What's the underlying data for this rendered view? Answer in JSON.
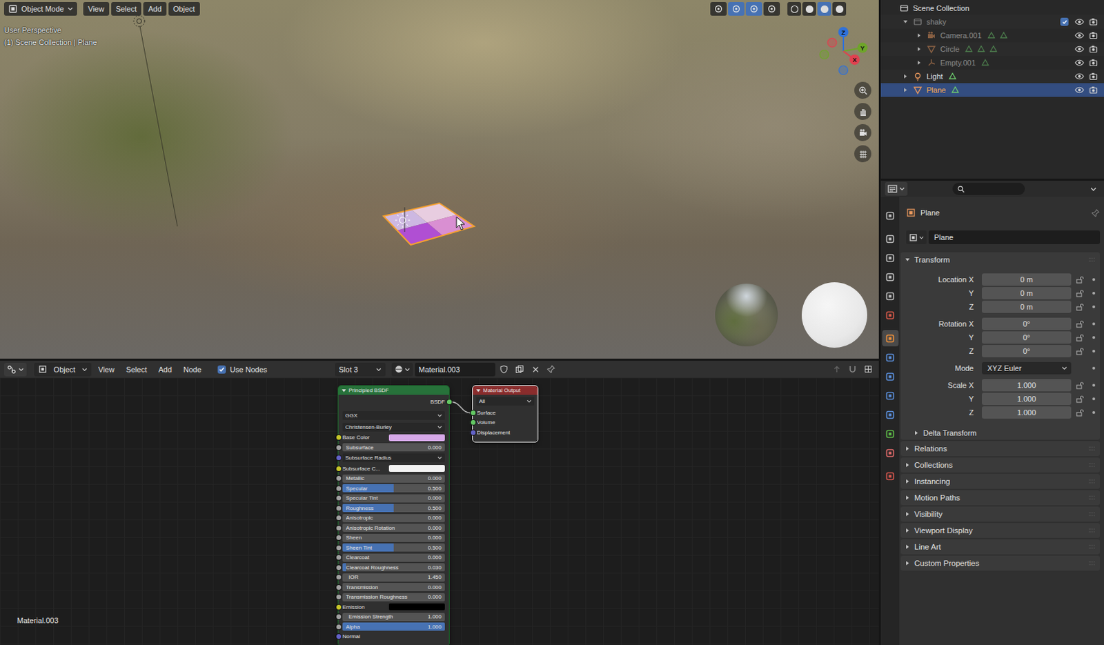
{
  "viewport": {
    "mode": "Object Mode",
    "menus": [
      "View",
      "Select",
      "Add",
      "Object"
    ],
    "toggles": [
      {
        "active": false
      },
      {
        "active": true
      },
      {
        "active": true
      },
      {
        "active": false
      }
    ],
    "shading": [
      {
        "selected": false
      },
      {
        "selected": false
      },
      {
        "selected": true
      },
      {
        "selected": false
      }
    ],
    "info": [
      "User Perspective",
      "(1) Scene Collection | Plane"
    ],
    "axes": [
      {
        "label": "Z",
        "color": "#2f71d9"
      },
      {
        "label": "Y",
        "color": "#6ea529"
      },
      {
        "label": "X",
        "color": "#e0404f"
      }
    ]
  },
  "node_editor": {
    "editor_mode": "Object",
    "menus": [
      "View",
      "Select",
      "Add",
      "Node"
    ],
    "use_nodes": {
      "label": "Use Nodes",
      "checked": true
    },
    "slot": "Slot 3",
    "material": "Material.003",
    "footer": "Material.003",
    "principled": {
      "title": "Principled BSDF",
      "output": {
        "label": "BSDF",
        "color": "#63c763"
      },
      "inputs": [
        {
          "kind": "dropdown",
          "label": "GGX"
        },
        {
          "kind": "dropdown",
          "label": "Christensen-Burley"
        },
        {
          "kind": "color",
          "label": "Base Color",
          "swatch": "#d6a9e8",
          "color": "#c7c729"
        },
        {
          "kind": "value",
          "label": "Subsurface",
          "value": "0.000",
          "level": 0,
          "color": "#a1a1a1"
        },
        {
          "kind": "vector",
          "label": "Subsurface Radius",
          "color": "#6363c7"
        },
        {
          "kind": "color",
          "label": "Subsurface C...",
          "swatch": "#f2f2f2",
          "color": "#c7c729"
        },
        {
          "kind": "value",
          "label": "Metallic",
          "value": "0.000",
          "level": 0,
          "color": "#a1a1a1"
        },
        {
          "kind": "value",
          "label": "Specular",
          "value": "0.500",
          "level": 0.5,
          "color": "#a1a1a1"
        },
        {
          "kind": "value",
          "label": "Specular Tint",
          "value": "0.000",
          "level": 0,
          "color": "#a1a1a1"
        },
        {
          "kind": "value",
          "label": "Roughness",
          "value": "0.500",
          "level": 0.5,
          "color": "#a1a1a1"
        },
        {
          "kind": "value",
          "label": "Anisotropic",
          "value": "0.000",
          "level": 0,
          "color": "#a1a1a1"
        },
        {
          "kind": "value",
          "label": "Anisotropic Rotation",
          "value": "0.000",
          "level": 0,
          "color": "#a1a1a1"
        },
        {
          "kind": "value",
          "label": "Sheen",
          "value": "0.000",
          "level": 0,
          "color": "#a1a1a1"
        },
        {
          "kind": "value",
          "label": "Sheen Tint",
          "value": "0.500",
          "level": 0.5,
          "color": "#a1a1a1"
        },
        {
          "kind": "value",
          "label": "Clearcoat",
          "value": "0.000",
          "level": 0,
          "color": "#a1a1a1"
        },
        {
          "kind": "value",
          "label": "Clearcoat Roughness",
          "value": "0.030",
          "level": 0.03,
          "color": "#a1a1a1"
        },
        {
          "kind": "field",
          "label": "IOR",
          "value": "1.450",
          "color": "#a1a1a1"
        },
        {
          "kind": "value",
          "label": "Transmission",
          "value": "0.000",
          "level": 0,
          "color": "#a1a1a1"
        },
        {
          "kind": "value",
          "label": "Transmission Roughness",
          "value": "0.000",
          "level": 0,
          "color": "#a1a1a1"
        },
        {
          "kind": "color",
          "label": "Emission",
          "swatch": "#000000",
          "color": "#c7c729"
        },
        {
          "kind": "field",
          "label": "Emission Strength",
          "value": "1.000",
          "color": "#a1a1a1"
        },
        {
          "kind": "value",
          "label": "Alpha",
          "value": "1.000",
          "level": 1,
          "color": "#a1a1a1"
        },
        {
          "kind": "socket",
          "label": "Normal",
          "color": "#6363c7"
        }
      ]
    },
    "output": {
      "title": "Material Output",
      "target": "All",
      "inputs": [
        {
          "label": "Surface",
          "color": "#63c763",
          "linked": true
        },
        {
          "label": "Volume",
          "color": "#63c763",
          "linked": false
        },
        {
          "label": "Displacement",
          "color": "#6363c7",
          "linked": false
        }
      ]
    }
  },
  "outliner": {
    "rows": [
      {
        "label": "Scene Collection",
        "depth": 0,
        "kind": "scene",
        "expanded": true,
        "dimmed": false,
        "selected": false,
        "extras": 0
      },
      {
        "label": "shaky",
        "depth": 1,
        "kind": "collection",
        "expanded": true,
        "dimmed": true,
        "selected": false,
        "extras": 0,
        "checked": true,
        "visible": true
      },
      {
        "label": "Camera.001",
        "depth": 2,
        "kind": "camera",
        "expanded": false,
        "dimmed": true,
        "selected": false,
        "extras": 2,
        "visible": true
      },
      {
        "label": "Circle",
        "depth": 2,
        "kind": "mesh",
        "expanded": false,
        "dimmed": true,
        "selected": false,
        "extras": 3,
        "visible": true
      },
      {
        "label": "Empty.001",
        "depth": 2,
        "kind": "empty",
        "expanded": false,
        "dimmed": true,
        "selected": false,
        "extras": 1,
        "visible": true
      },
      {
        "label": "Light",
        "depth": 1,
        "kind": "light",
        "expanded": false,
        "dimmed": false,
        "selected": false,
        "extras": 1,
        "visible": true
      },
      {
        "label": "Plane",
        "depth": 1,
        "kind": "mesh",
        "expanded": false,
        "dimmed": false,
        "selected": true,
        "extras": 1,
        "visible": true
      }
    ]
  },
  "properties": {
    "tabs": [
      {
        "kind": "tool",
        "selected": false,
        "color": "#bdbdbd",
        "group_start": false
      },
      {
        "kind": "render",
        "selected": false,
        "color": "#bdbdbd",
        "group_start": true
      },
      {
        "kind": "output",
        "selected": false,
        "color": "#bdbdbd",
        "group_start": false
      },
      {
        "kind": "view-layer",
        "selected": false,
        "color": "#bdbdbd",
        "group_start": false
      },
      {
        "kind": "scene",
        "selected": false,
        "color": "#bdbdbd",
        "group_start": false
      },
      {
        "kind": "world",
        "selected": false,
        "color": "#d95a4a",
        "group_start": false
      },
      {
        "kind": "object",
        "selected": true,
        "color": "#f0913a",
        "group_start": true
      },
      {
        "kind": "modifier",
        "selected": false,
        "color": "#5b8fdb",
        "group_start": false
      },
      {
        "kind": "particles",
        "selected": false,
        "color": "#5b8fdb",
        "group_start": false
      },
      {
        "kind": "physics",
        "selected": false,
        "color": "#5b8fdb",
        "group_start": false
      },
      {
        "kind": "constraints",
        "selected": false,
        "color": "#5b8fdb",
        "group_start": false
      },
      {
        "kind": "data",
        "selected": false,
        "color": "#5fbd48",
        "group_start": false
      },
      {
        "kind": "material",
        "selected": false,
        "color": "#e06a6a",
        "group_start": false
      },
      {
        "kind": "texture",
        "selected": false,
        "color": "#d9584f",
        "group_start": true
      }
    ],
    "context": "Plane",
    "datablock": "Plane",
    "transform": {
      "title": "Transform",
      "expanded": true,
      "rows": [
        {
          "label": "Location X",
          "value": "0 m",
          "kind": "field",
          "locked": false,
          "group_start": true
        },
        {
          "label": "Y",
          "value": "0 m",
          "kind": "field",
          "locked": false,
          "group_start": false
        },
        {
          "label": "Z",
          "value": "0 m",
          "kind": "field",
          "locked": false,
          "group_start": false
        },
        {
          "label": "Rotation X",
          "value": "0°",
          "kind": "field",
          "locked": false,
          "group_start": true
        },
        {
          "label": "Y",
          "value": "0°",
          "kind": "field",
          "locked": false,
          "group_start": false
        },
        {
          "label": "Z",
          "value": "0°",
          "kind": "field",
          "locked": false,
          "group_start": false
        },
        {
          "label": "Mode",
          "value": "XYZ Euler",
          "kind": "dropdown",
          "group_start": true
        },
        {
          "label": "Scale X",
          "value": "1.000",
          "kind": "field",
          "locked": false,
          "group_start": true
        },
        {
          "label": "Y",
          "value": "1.000",
          "kind": "field",
          "locked": false,
          "group_start": false
        },
        {
          "label": "Z",
          "value": "1.000",
          "kind": "field",
          "locked": false,
          "group_start": false
        }
      ]
    },
    "delta": {
      "title": "Delta Transform",
      "expanded": false
    },
    "panels": [
      {
        "title": "Relations",
        "expanded": false
      },
      {
        "title": "Collections",
        "expanded": false
      },
      {
        "title": "Instancing",
        "expanded": false
      },
      {
        "title": "Motion Paths",
        "expanded": false
      },
      {
        "title": "Visibility",
        "expanded": false
      },
      {
        "title": "Viewport Display",
        "expanded": false
      },
      {
        "title": "Line Art",
        "expanded": false
      },
      {
        "title": "Custom Properties",
        "expanded": false
      }
    ]
  }
}
